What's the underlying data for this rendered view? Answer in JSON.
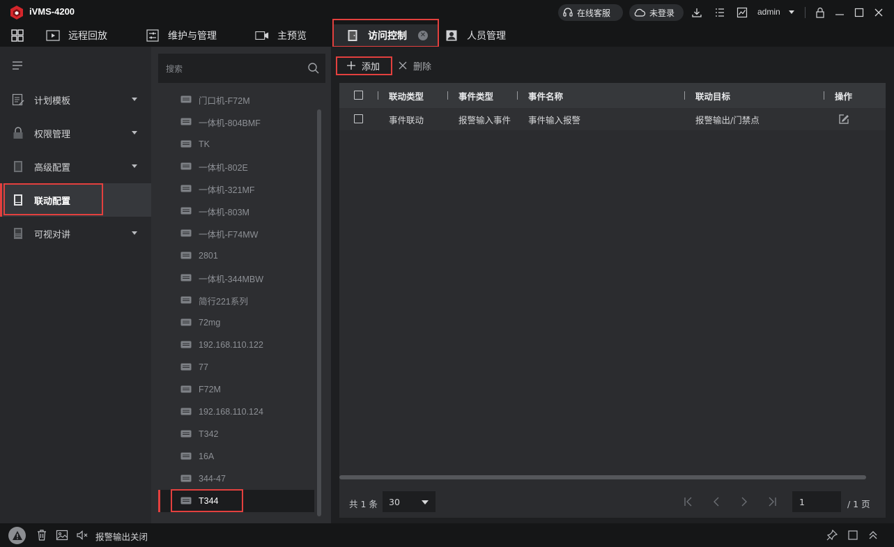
{
  "app": {
    "name": "iVMS-4200"
  },
  "titlebar": {
    "service_label": "在线客服",
    "login_label": "未登录",
    "user": "admin"
  },
  "tabs": [
    {
      "label": "远程回放"
    },
    {
      "label": "维护与管理"
    },
    {
      "label": "主预览"
    },
    {
      "label": "访问控制",
      "active": true
    },
    {
      "label": "人员管理"
    }
  ],
  "sidebar": {
    "items": [
      {
        "label": "计划模板",
        "expandable": true
      },
      {
        "label": "权限管理",
        "expandable": true
      },
      {
        "label": "高级配置",
        "expandable": true
      },
      {
        "label": "联动配置",
        "active": true
      },
      {
        "label": "可视对讲",
        "expandable": true
      }
    ]
  },
  "devices": {
    "search_placeholder": "搜索",
    "items": [
      "门口机-F72M",
      "一体机-804BMF",
      "TK",
      "一体机-802E",
      "一体机-321MF",
      "一体机-803M",
      "一体机-F74MW",
      "2801",
      "一体机-344MBW",
      "简行221系列",
      "72mg",
      "192.168.110.122",
      "77",
      "F72M",
      "192.168.110.124",
      "T342",
      "16A",
      "344-47",
      "T344"
    ],
    "selected": "T344"
  },
  "toolbar": {
    "add_label": "添加",
    "delete_label": "删除"
  },
  "table": {
    "headers": [
      "联动类型",
      "事件类型",
      "事件名称",
      "联动目标",
      "操作"
    ],
    "rows": [
      {
        "linkage_type": "事件联动",
        "event_type": "报警输入事件",
        "event_name": "事件输入报警",
        "target": "报警输出/门禁点"
      }
    ]
  },
  "pager": {
    "total_text": "共 1 条",
    "page_size": "30",
    "current_page": "1",
    "total_pages_text": "/ 1 页"
  },
  "statusbar": {
    "text": "报警输出关闭"
  },
  "colors": {
    "accent": "#e3403e",
    "background": "#1e1f21",
    "panel": "#2d2e31",
    "titlebar": "#151617"
  }
}
